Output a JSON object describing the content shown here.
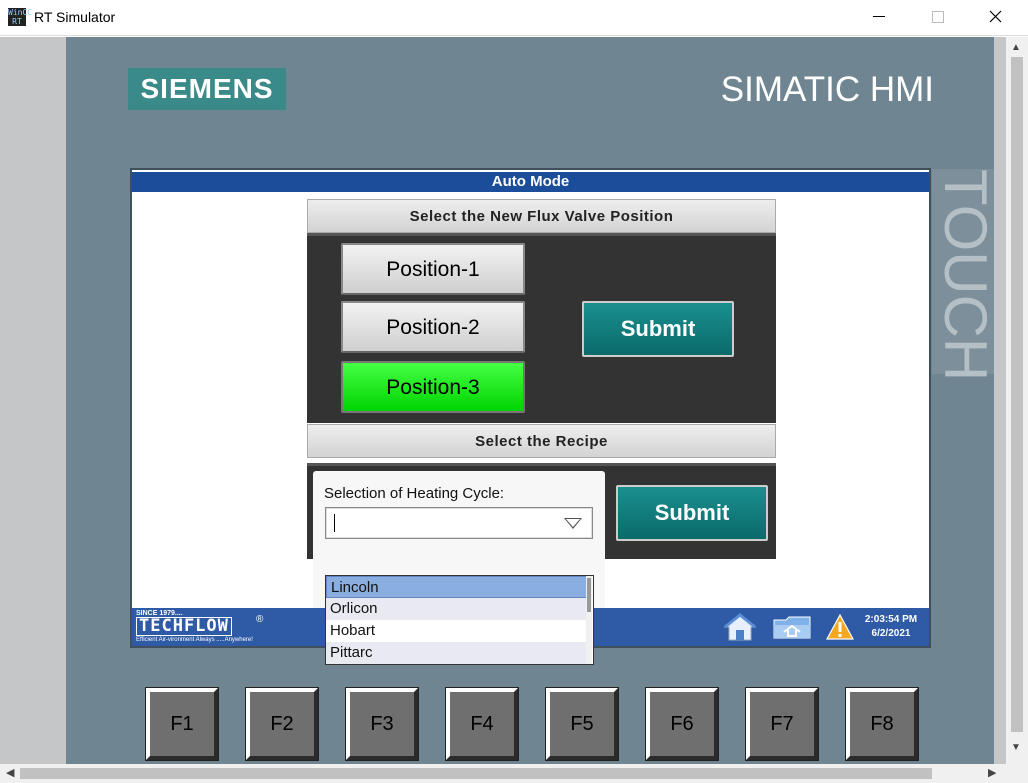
{
  "window": {
    "title": "RT Simulator",
    "app_icon_text": "WinCC RT",
    "minimize_icon": "minimize-icon",
    "maximize_icon": "maximize-icon",
    "close_icon": "close-icon"
  },
  "device": {
    "brand": "SIEMENS",
    "model": "SIMATIC HMI",
    "side_label": "TOUCH"
  },
  "screen": {
    "header": "Auto Mode",
    "flux": {
      "title": "Select the New Flux Valve Position",
      "positions": [
        "Position-1",
        "Position-2",
        "Position-3"
      ],
      "selected": "Position-3",
      "selected_color": "#00e000",
      "submit": "Submit"
    },
    "recipe": {
      "title": "Select the Recipe",
      "label": "Selection of Heating Cycle:",
      "value": "",
      "submit": "Submit",
      "options": [
        "Lincoln",
        "Orlicon",
        "Hobart",
        "Pittarc"
      ],
      "highlighted": "Lincoln"
    },
    "footer": {
      "logo_since": "SINCE 1979....",
      "logo_name": "TECHFLOW",
      "logo_reg": "®",
      "logo_tagline": "Efficient Air-vironment  Always .....Anywhere!",
      "time": "2:03:54 PM",
      "date": "6/2/2021",
      "icons": [
        "home-icon",
        "folder-icon",
        "warning-icon"
      ]
    }
  },
  "function_keys": [
    "F1",
    "F2",
    "F3",
    "F4",
    "F5",
    "F6",
    "F7",
    "F8"
  ],
  "colors": {
    "device_bg": "#708592",
    "header_blue": "#1c4d9a",
    "submit_teal": "#0f7d7d",
    "siemens_teal": "#3b8a8a"
  }
}
